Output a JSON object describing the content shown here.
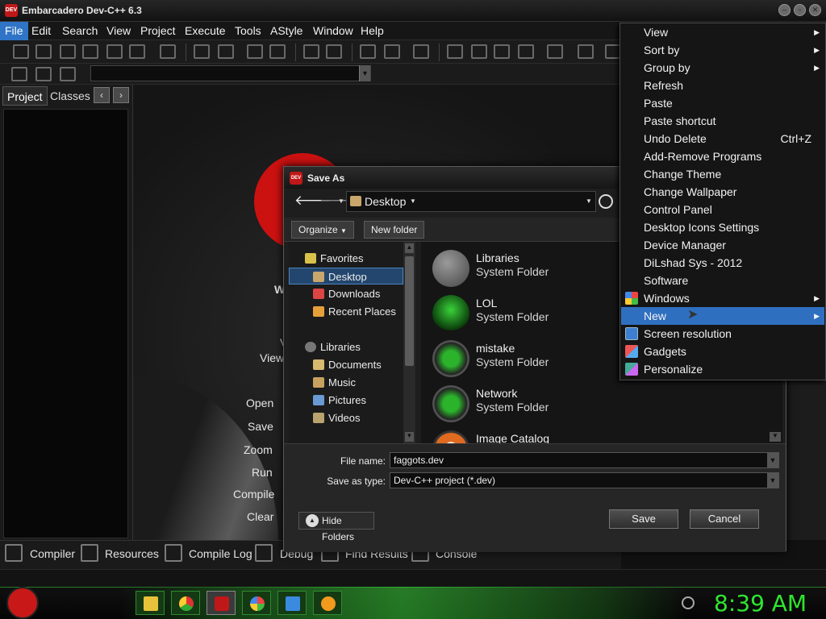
{
  "app": {
    "title": "Embarcadero Dev-C++ 6.3",
    "icon": "devcpp-app-icon"
  },
  "menubar": [
    "File",
    "Edit",
    "Search",
    "View",
    "Project",
    "Execute",
    "Tools",
    "AStyle",
    "Window",
    "Help"
  ],
  "left_panel": {
    "tabs": [
      "Project",
      "Classes"
    ]
  },
  "welcome": {
    "labels": [
      "W",
      "V",
      "View",
      "Open",
      "Save",
      "Zoom",
      "Run",
      "Compile",
      "Clear"
    ]
  },
  "bottom_tabs": [
    "Compiler",
    "Resources",
    "Compile Log",
    "Debug",
    "Find Results",
    "Console"
  ],
  "save_dialog": {
    "title": "Save As",
    "location": "Desktop",
    "organize": "Organize",
    "new_folder": "New folder",
    "nav": {
      "favorites": "Favorites",
      "desktop": "Desktop",
      "downloads": "Downloads",
      "recent": "Recent Places",
      "libraries": "Libraries",
      "documents": "Documents",
      "music": "Music",
      "pictures": "Pictures",
      "videos": "Videos"
    },
    "files": [
      {
        "name": "Libraries",
        "type": "System Folder"
      },
      {
        "name": "LOL",
        "type": "System Folder"
      },
      {
        "name": "mistake",
        "type": "System Folder"
      },
      {
        "name": "Network",
        "type": "System Folder"
      },
      {
        "name": "Image Catalog",
        "type": ""
      }
    ],
    "file_name_label": "File name:",
    "file_name_value": "faggots.dev",
    "save_type_label": "Save as type:",
    "save_type_value": "Dev-C++ project (*.dev)",
    "hide_folders": "Hide Folders",
    "save": "Save",
    "cancel": "Cancel"
  },
  "context_menu": {
    "items": [
      {
        "label": "View",
        "submenu": true
      },
      {
        "label": "Sort by",
        "submenu": true
      },
      {
        "label": "Group by",
        "submenu": true
      },
      {
        "label": "Refresh"
      },
      {
        "label": "Paste"
      },
      {
        "label": "Paste shortcut"
      },
      {
        "label": "Undo Delete",
        "shortcut": "Ctrl+Z"
      },
      {
        "label": "Add-Remove Programs"
      },
      {
        "label": "Change Theme"
      },
      {
        "label": "Change Wallpaper"
      },
      {
        "label": "Control Panel"
      },
      {
        "label": "Desktop Icons Settings"
      },
      {
        "label": "Device Manager"
      },
      {
        "label": "DiLshad Sys - 2012"
      },
      {
        "label": "Software"
      },
      {
        "label": "Windows",
        "submenu": true,
        "icon": "windows-icon"
      },
      {
        "label": "New",
        "submenu": true,
        "highlighted": true
      },
      {
        "label": "Screen resolution",
        "icon": "monitor-icon"
      },
      {
        "label": "Gadgets",
        "icon": "gadgets-icon"
      },
      {
        "label": "Personalize",
        "icon": "personalize-icon"
      }
    ]
  },
  "taskbar": {
    "clock": "8:39 AM"
  },
  "colors": {
    "accent": "#2f6fc0",
    "clock": "#2fe62f",
    "brand": "#cc1111"
  }
}
